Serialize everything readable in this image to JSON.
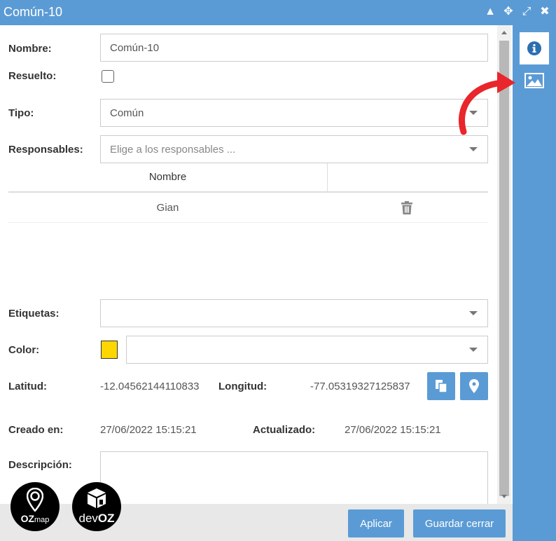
{
  "window": {
    "title": "Común-10"
  },
  "titlebar_icons": [
    "collapse-icon",
    "move-icon",
    "expand-icon",
    "close-icon"
  ],
  "form": {
    "nombre_label": "Nombre:",
    "nombre_value": "Común-10",
    "resuelto_label": "Resuelto:",
    "resuelto_checked": false,
    "tipo_label": "Tipo:",
    "tipo_value": "Común",
    "responsables_label": "Responsables:",
    "responsables_placeholder": "Elige a los responsables ...",
    "table": {
      "headers": [
        "Nombre",
        ""
      ],
      "rows": [
        {
          "nombre": "Gian"
        }
      ]
    },
    "etiquetas_label": "Etiquetas:",
    "color_label": "Color:",
    "color_swatch": "#ffd700",
    "latitud_label": "Latitud:",
    "latitud_value": "-12.04562144110833",
    "longitud_label": "Longitud:",
    "longitud_value": "-77.05319327125837",
    "creado_label": "Creado en:",
    "creado_value": "27/06/2022 15:15:21",
    "actualizado_label": "Actualizado:",
    "actualizado_value": "27/06/2022 15:15:21",
    "descripcion_label": "Descripción:"
  },
  "buttons": {
    "aplicar": "Aplicar",
    "guardar_cerrar": "Guardar cerrar"
  },
  "logos": {
    "ozmap": {
      "bold": "OZ",
      "light": "map"
    },
    "devoz": {
      "light": "dev",
      "bold": "OZ"
    }
  },
  "colors": {
    "accent": "#5b9bd5",
    "arrow": "#e8262b"
  }
}
